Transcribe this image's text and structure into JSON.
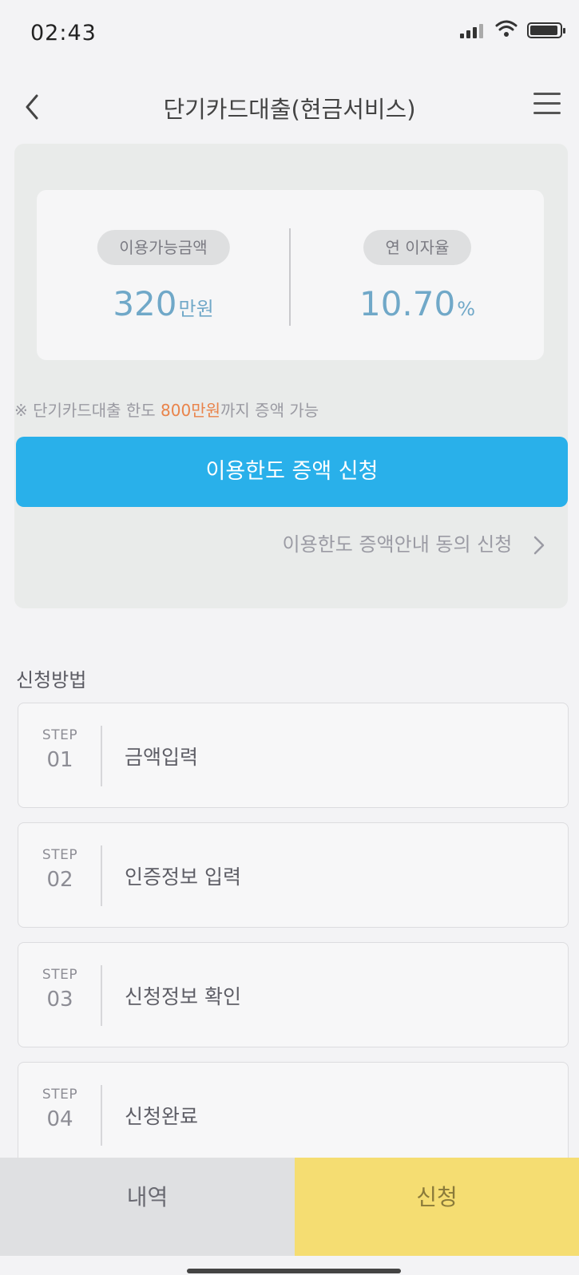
{
  "status_bar": {
    "time": "02:43"
  },
  "header": {
    "title": "단기카드대출(현금서비스)"
  },
  "summary": {
    "available": {
      "label": "이용가능금액",
      "value": "320",
      "unit": "만원"
    },
    "rate": {
      "label": "연 이자율",
      "value": "10.70",
      "unit": "%"
    }
  },
  "limit_note": {
    "prefix": "※ 단기카드대출 한도 ",
    "highlight": "800만원",
    "suffix": "까지 증액 가능"
  },
  "increase_button": {
    "label": "이용한도 증액 신청"
  },
  "consent_link": {
    "label": "이용한도 증액안내 동의 신청"
  },
  "section": {
    "title": "신청방법"
  },
  "steps": [
    {
      "step": "STEP",
      "num": "01",
      "title": "금액입력"
    },
    {
      "step": "STEP",
      "num": "02",
      "title": "인증정보 입력"
    },
    {
      "step": "STEP",
      "num": "03",
      "title": "신청정보 확인"
    },
    {
      "step": "STEP",
      "num": "04",
      "title": "신청완료"
    }
  ],
  "bottom_bar": {
    "history_label": "내역",
    "apply_label": "신청"
  },
  "colors": {
    "accent": "#29b0ea",
    "highlight": "#e9834a",
    "apply": "#f5dd72"
  }
}
